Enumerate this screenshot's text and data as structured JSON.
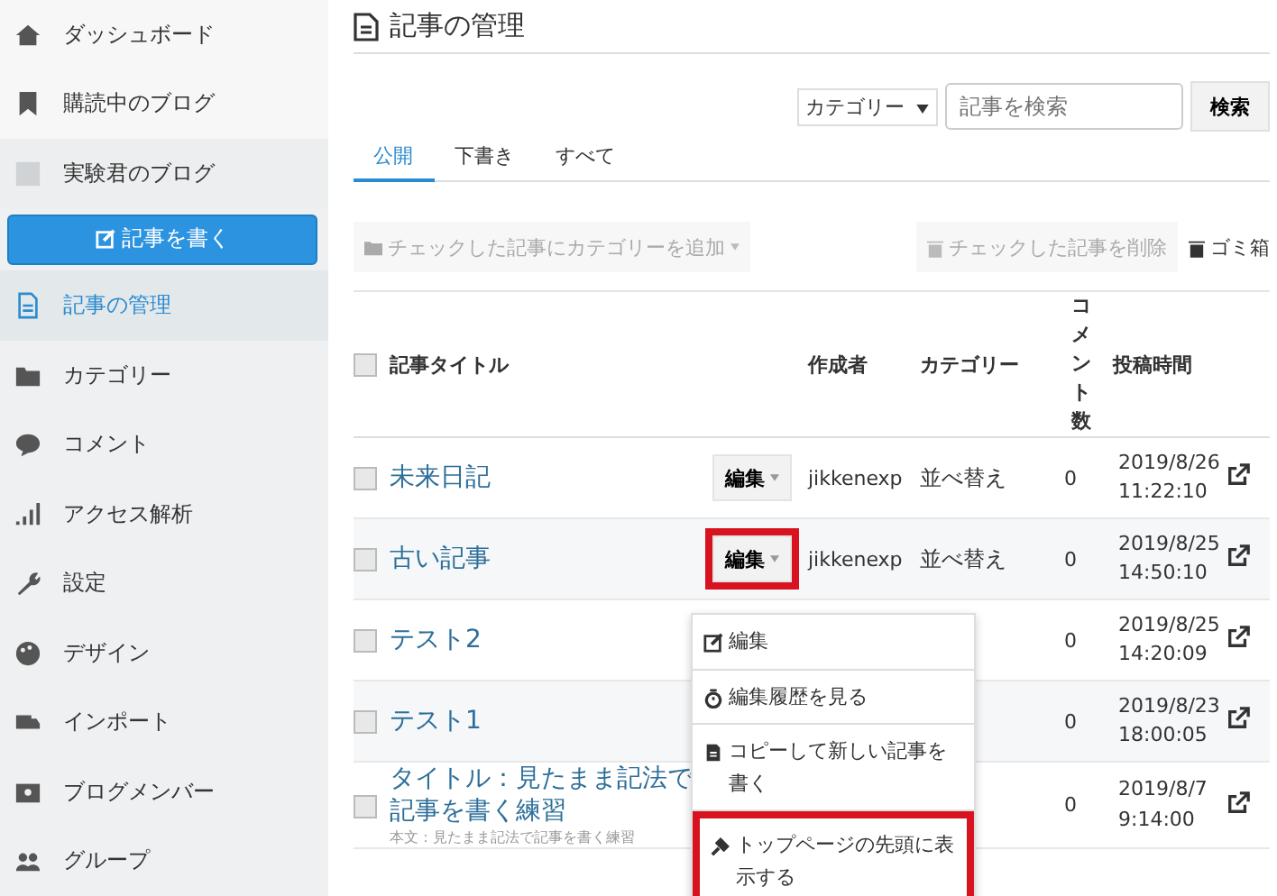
{
  "sidebar": {
    "items": [
      {
        "label": "ダッシュボード",
        "selected": false,
        "kind": "item"
      },
      {
        "label": "購読中のブログ",
        "selected": false,
        "kind": "item"
      },
      {
        "label": "実験君のブログ",
        "selected": false,
        "kind": "blog"
      },
      {
        "label": "記事を書く",
        "selected": false,
        "kind": "button"
      },
      {
        "label": "記事の管理",
        "selected": true,
        "kind": "item"
      },
      {
        "label": "カテゴリー",
        "selected": false,
        "kind": "item"
      },
      {
        "label": "コメント",
        "selected": false,
        "kind": "item"
      },
      {
        "label": "アクセス解析",
        "selected": false,
        "kind": "item"
      },
      {
        "label": "設定",
        "selected": false,
        "kind": "item"
      },
      {
        "label": "デザイン",
        "selected": false,
        "kind": "item"
      },
      {
        "label": "インポート",
        "selected": false,
        "kind": "item"
      },
      {
        "label": "ブログメンバー",
        "selected": false,
        "kind": "item"
      },
      {
        "label": "グループ",
        "selected": false,
        "kind": "item"
      }
    ]
  },
  "page_title": "記事の管理",
  "filter": {
    "category": "カテゴリー",
    "search_placeholder": "記事を検索",
    "search_button": "検索"
  },
  "tabs": [
    {
      "label": "公開",
      "selected": true
    },
    {
      "label": "下書き",
      "selected": false
    },
    {
      "label": "すべて",
      "selected": false
    }
  ],
  "actions": {
    "add_category": "チェックした記事にカテゴリーを追加",
    "delete": "チェックした記事を削除",
    "trash": "ゴミ箱"
  },
  "table": {
    "select_all_checked": false,
    "columns": [
      "記事タイトル",
      "作成者",
      "カテゴリー",
      "コメント数",
      "投稿時間"
    ],
    "rows": [
      {
        "title": "未来日記",
        "edit": "編集",
        "highlighted": false,
        "author": "jikkenexp",
        "category": "並べ替え",
        "comments": "0",
        "date": "2019/8/26",
        "time": "11:22:10",
        "checked": false
      },
      {
        "title": "古い記事",
        "edit": "編集",
        "highlighted": true,
        "author": "jikkenexp",
        "category": "並べ替え",
        "comments": "0",
        "date": "2019/8/25",
        "time": "14:50:10",
        "checked": false
      },
      {
        "title": "テスト2",
        "comments": "0",
        "date": "2019/8/25",
        "time": "14:20:09",
        "checked": false
      },
      {
        "title": "テスト1",
        "comments": "0",
        "date": "2019/8/23",
        "time": "18:00:05",
        "checked": false
      },
      {
        "title": "タイトル：見たまま記法で記事を書く練習",
        "excerpt": "本文：見たまま記法で記事を書く練習",
        "comments": "0",
        "date": "2019/8/7",
        "time": "9:14:00",
        "checked": false
      }
    ]
  },
  "edit_menu": {
    "items": [
      {
        "label": "編集",
        "highlighted": false
      },
      {
        "label": "編集履歴を見る",
        "highlighted": false
      },
      {
        "label": "コピーして新しい記事を書く",
        "highlighted": false
      },
      {
        "label": "トップページの先頭に表示する",
        "highlighted": true
      }
    ]
  }
}
